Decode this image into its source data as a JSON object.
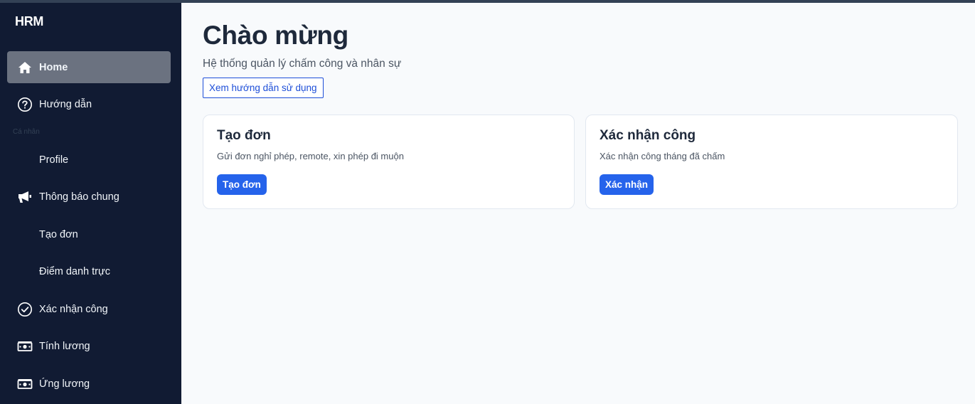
{
  "sidebar": {
    "brand": "HRM",
    "items": [
      {
        "label": "Home",
        "icon": "home-icon",
        "active": true
      },
      {
        "label": "Hướng dẫn",
        "icon": "help-circle-icon"
      },
      {
        "label": "Profile",
        "icon": ""
      },
      {
        "label": "Thông báo chung",
        "icon": "megaphone-icon"
      },
      {
        "label": "Tạo đơn",
        "icon": ""
      },
      {
        "label": "Điểm danh trực",
        "icon": ""
      },
      {
        "label": "Xác nhận công",
        "icon": "check-circle-icon"
      },
      {
        "label": "Tính lương",
        "icon": "money-icon"
      },
      {
        "label": "Ứng lương",
        "icon": "money-icon"
      }
    ],
    "section_label": "Cá nhân"
  },
  "main": {
    "title": "Chào mừng",
    "subtitle": "Hệ thống quản lý chấm công và nhân sự",
    "guide_button": "Xem hướng dẫn sử dụng",
    "cards": [
      {
        "title": "Tạo đơn",
        "description": "Gửi đơn nghỉ phép, remote, xin phép đi muộn",
        "button": "Tạo đơn"
      },
      {
        "title": "Xác nhận công",
        "description": "Xác nhận công tháng đã chấm",
        "button": "Xác nhận"
      }
    ]
  },
  "colors": {
    "sidebar_bg": "#111b33",
    "active_item": "#6b7280",
    "primary": "#2563eb",
    "content_bg": "#f8fafc"
  }
}
